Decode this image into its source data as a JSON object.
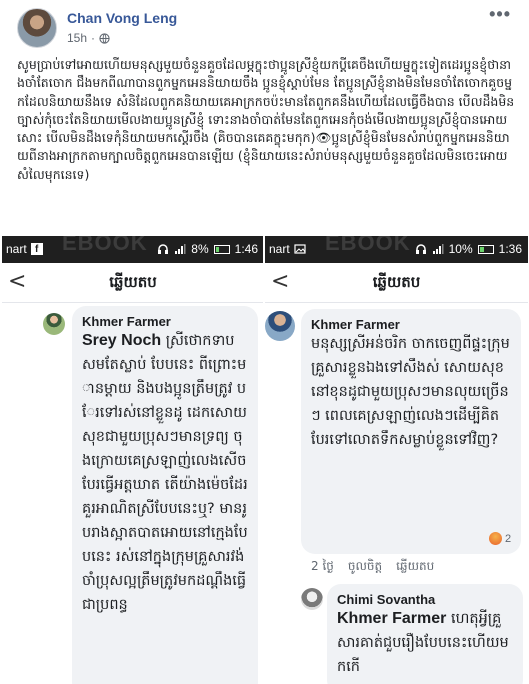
{
  "post": {
    "author": "Chan Vong Leng",
    "time": "15h",
    "more": "•••",
    "text": "សូមប្រាប់ទៅអោយហើយមនុស្សមួយចំនួនគួចដែលម្ភក្ខុះថាប្អូនស្រីខ្ញុំយកប្ដីគេចឹងហើយម្នក្ខុះទៀតដេរប្អូនខ្ញុំថានាងចាំតែចោក ជឹងមកពីណាបានពួកម្នកអេននិយាយចឹង ប្អូនខ្ញុំស្ដាប់មែន តែប្អូនស្រីខ្ញុំនាងមិនមែនចាំតែចោកគួចម្នកដែលនិយាយនឹងទេ សំនិដែលពួកគនិយាយគេអាក្រកចប៉ះមានតែពួកគនឹងហើយដែលធ្វើចឹងបាន បើលដឹងមិនច្បាស់កុំចេះតែនិយាយមើលងាយប្អូនស្រីខ្ញុំ ទោះនាងចាំបាត់មែនតែពួកអេនកុំចង់មើលងាយប្អូនស្រីខ្ញុំបានអោយសោះ បើលមិនដឹងទេកុំនិយាយមកស្ដើរចឹង (គិចបានគេគក្ខុះមកុក)👁ប្អូនស្រីខ្ញុំមិនមែនសំរាប់ពួកម្នកអេននិយាយពីនាងអាក្រកតាមក្បាលចិត្តពួកអេនបានឡើយ (ខ្ញុំនិយាយនេះសំរាប់មនុស្សមួយចំនួនគួចដែលមិនចេះអោយសំលៃមុកនេទេ)"
  },
  "left_screenshot": {
    "status_left": "nart",
    "status_percent": "8%",
    "status_time": "1:46",
    "watermark": "EBOOK",
    "back": "<",
    "title": "ឆ្លើយតប",
    "comment": {
      "author": "Khmer Farmer",
      "tag": "Srey Noch",
      "text": "ស្រីថោកទាប សមតែស្លាប់ បែបនេះ ពីព្រោះមានម្ដាយ និងបងប្អូនត្រឹមត្រូវ បែរទៅរស់នៅខ្លួនដូ ដេកសោយសុខជាមួយប្រុសៗមានទ្រព្យ ចុងក្រោយគេស្រឡាញ់លេងសើច បែរធ្វើអត្តឃាត តើយ៉ាងម៉េចដែរ គួរអាណិតស្រីបែបនេះឬ? មានរូបរាងស្អាតបាតអោយនៅក្មេងបែបនេះ រស់នៅក្នុងក្រុមគ្រួសារវង់ចាំប្រុសល្អត្រឹមត្រូវមកដណ្ដឹងធ្វើជាប្រពន្ធ"
    }
  },
  "right_screenshot": {
    "status_left": "nart",
    "status_percent": "10%",
    "status_time": "1:36",
    "watermark": "EBOOK",
    "back": "<",
    "title": "ឆ្លើយតប",
    "comment": {
      "author": "Khmer Farmer",
      "text": "មនុស្សស្រីអន់ចរិក ចាកចេញពីផ្ទះក្រុមគ្រួសារខ្លួនឯងទៅសឹងស់ សោយសុខនៅខុនដូជាមួយប្រុសៗមានលុយច្រើនៗ ពេលគេស្រឡាញ់លេងៗដើម្បីគិត បែរទៅលោតទឹកសម្លាប់ខ្លួនទៅវិញ?",
      "reaction_count": "2",
      "age": "2 ថ្ងៃ",
      "like": "ចូលចិត្ត",
      "reply": "ឆ្លើយតប"
    },
    "reply": {
      "author": "Chimi Sovantha",
      "tag": "Khmer Farmer",
      "text": "ហេតុអ្វីគ្រួសារគាត់ជួបរឿងបែបនេះហើយមកកើ"
    }
  }
}
